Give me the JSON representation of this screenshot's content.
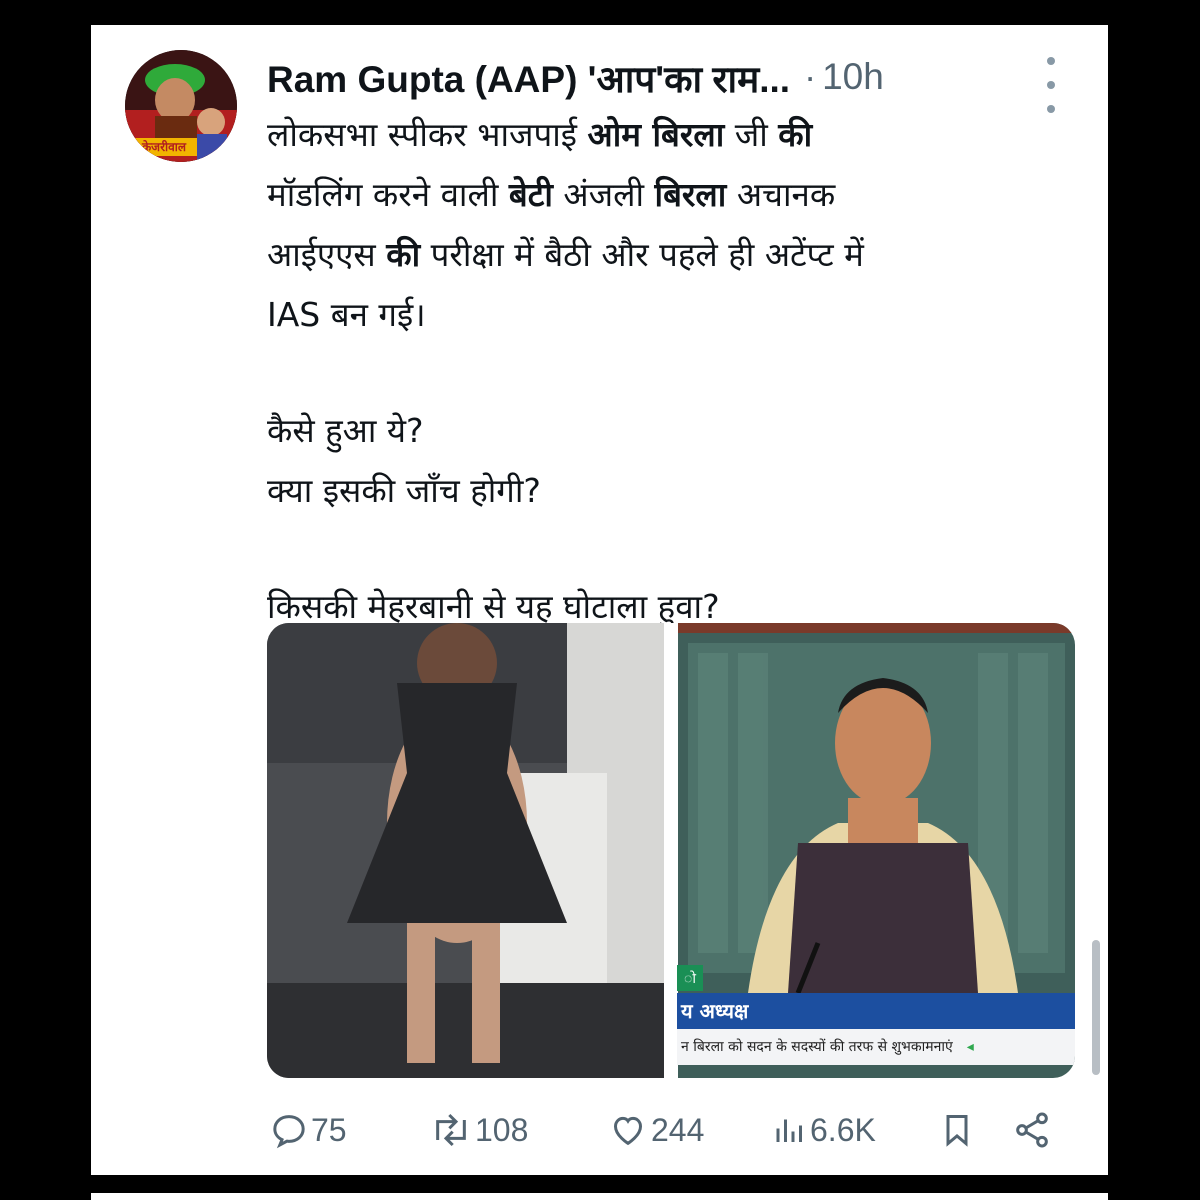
{
  "tweet": {
    "author": "Ram Gupta (AAP) 'आप'का राम...",
    "dot": "·",
    "time": "10h",
    "avatar_banner": "केजरीवाल",
    "lines": [
      [
        "लोकसभा स्पीकर भाजपाई ",
        {
          "b": "ओम बिरला"
        },
        " जी ",
        {
          "b": "की"
        }
      ],
      [
        "मॉडलिंग करने वाली ",
        {
          "b": "बेटी"
        },
        " अंजली ",
        {
          "b": "बिरला"
        },
        " अचानक"
      ],
      [
        "आईएएस ",
        {
          "b": "की"
        },
        " परीक्षा में बैठी और पहले ही अटेंप्ट में"
      ],
      [
        "IAS बन गई।"
      ]
    ],
    "line5": "कैसे हुआ ये?",
    "line6": "क्या इसकी जाँच होगी?",
    "line7": "किसकी मेहरबानी से यह घोटाला हुवा?"
  },
  "media": {
    "caption_title": "य अध्यक्ष",
    "caption_ticker": "न बिरला को सदन के सदस्यों की तरफ से शुभकामनाएं",
    "green_tag": "ो"
  },
  "actions": {
    "replies": "75",
    "retweets": "108",
    "likes": "244",
    "views": "6.6K"
  },
  "icons": {
    "reply": "reply-icon",
    "retweet": "retweet-icon",
    "like": "heart-icon",
    "views": "views-icon",
    "bookmark": "bookmark-icon",
    "share": "share-icon",
    "more": "more-vertical-icon"
  },
  "colors": {
    "text": "#0f1419",
    "muted": "#536471",
    "background": "#ffffff",
    "frame": "#000000"
  }
}
